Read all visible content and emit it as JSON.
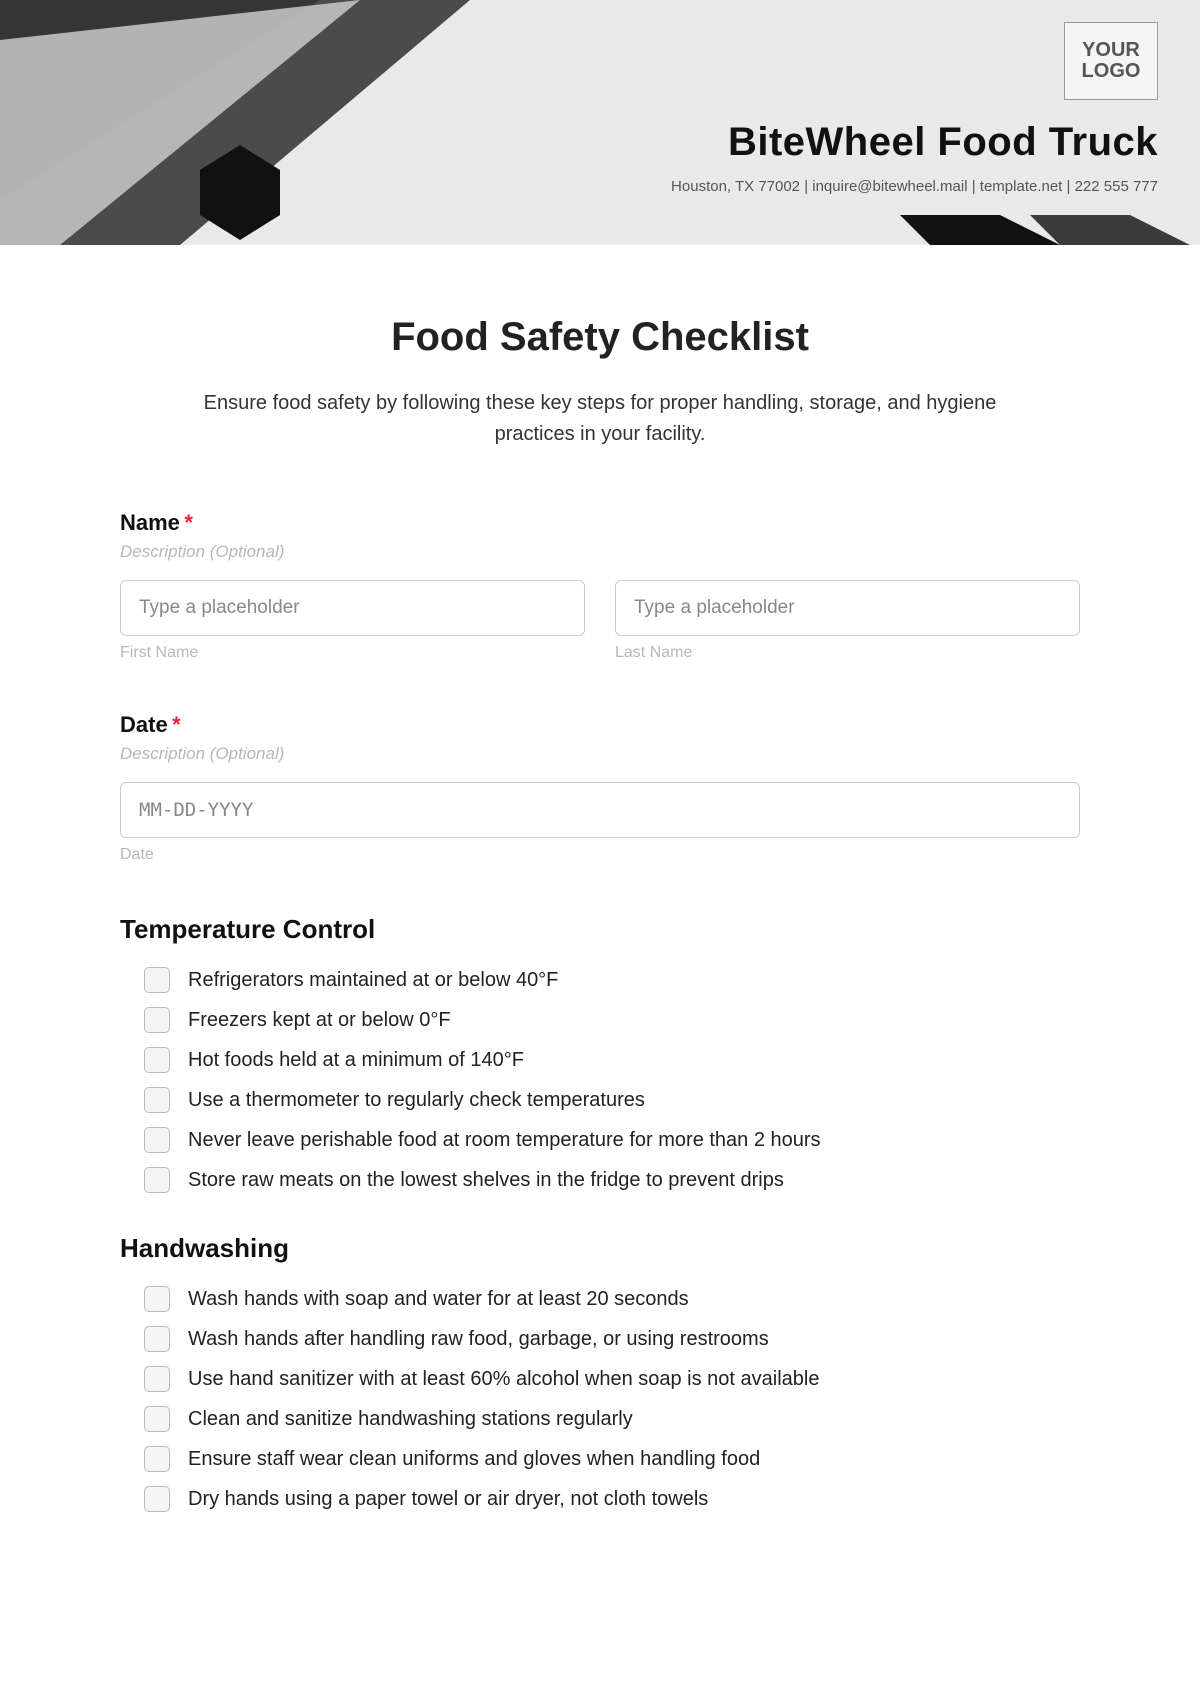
{
  "header": {
    "logo_text": "YOUR LOGO",
    "company_name": "BiteWheel Food Truck",
    "contact_line": "Houston, TX 77002 | inquire@bitewheel.mail | template.net | 222 555 777"
  },
  "form": {
    "title": "Food Safety Checklist",
    "description": "Ensure food safety by following these key steps for proper handling, storage, and hygiene practices in your facility."
  },
  "name_field": {
    "label": "Name",
    "required_marker": "*",
    "description": "Description (Optional)",
    "first_placeholder": "Type a placeholder",
    "last_placeholder": "Type a placeholder",
    "first_sub": "First Name",
    "last_sub": "Last Name"
  },
  "date_field": {
    "label": "Date",
    "required_marker": "*",
    "description": "Description (Optional)",
    "placeholder": "MM-DD-YYYY",
    "sub": "Date"
  },
  "sections": [
    {
      "title": "Temperature Control",
      "items": [
        "Refrigerators maintained at or below 40°F",
        "Freezers kept at or below 0°F",
        "Hot foods held at a minimum of 140°F",
        "Use a thermometer to regularly check temperatures",
        "Never leave perishable food at room temperature for more than 2 hours",
        "Store raw meats on the lowest shelves in the fridge to prevent drips"
      ]
    },
    {
      "title": "Handwashing",
      "items": [
        "Wash hands with soap and water for at least 20 seconds",
        "Wash hands after handling raw food, garbage, or using restrooms",
        "Use hand sanitizer with at least 60% alcohol when soap is not available",
        "Clean and sanitize handwashing stations regularly",
        "Ensure staff wear clean uniforms and gloves when handling food",
        "Dry hands using a paper towel or air dryer, not cloth towels"
      ]
    }
  ]
}
